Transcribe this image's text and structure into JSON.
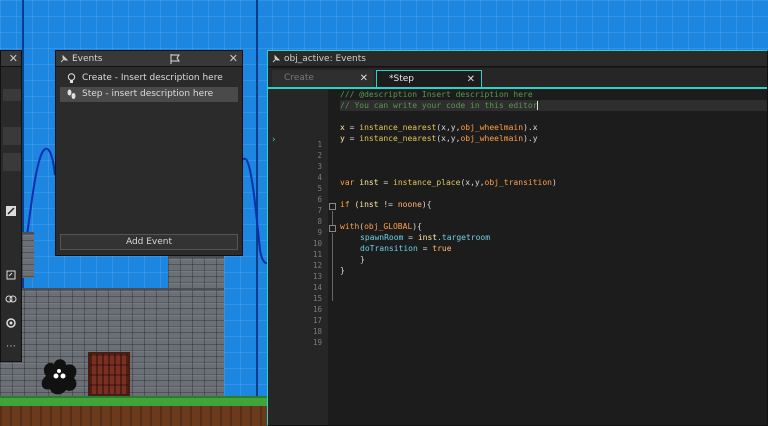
{
  "left_panel": {
    "close_label": "✕"
  },
  "events_panel": {
    "title": "Events",
    "close_label": "✕",
    "items": [
      {
        "label": "Create - Insert description here",
        "icon": "lightbulb-icon",
        "selected": false
      },
      {
        "label": "Step - insert description here",
        "icon": "footsteps-icon",
        "selected": true
      }
    ],
    "add_event_label": "Add Event"
  },
  "editor": {
    "title": "obj_active: Events",
    "tabs": [
      {
        "label": "Create",
        "active": false,
        "close": "✕"
      },
      {
        "label": "*Step",
        "active": true,
        "close": "✕"
      }
    ],
    "line_numbers": [
      "1",
      "2",
      "3",
      "4",
      "5",
      "6",
      "7",
      "8",
      "9",
      "10",
      "11",
      "12",
      "13",
      "14",
      "15",
      "16",
      "17",
      "18",
      "19"
    ],
    "lines": {
      "l1": "/// @description Insert description here",
      "l2": "// You can write your code in this editor",
      "l4a": "x",
      "l4b": " = ",
      "l4c": "instance_nearest",
      "l4d": "(x,y,",
      "l4e": "obj_wheelmain",
      "l4f": ").x",
      "l5a": "y",
      "l5b": " = ",
      "l5c": "instance_nearest",
      "l5d": "(x,y,",
      "l5e": "obj_wheelmain",
      "l5f": ").y",
      "l9a": "var",
      "l9b": " inst",
      "l9c": " = ",
      "l9d": "instance_place",
      "l9e": "(x,y,",
      "l9f": "obj_transition",
      "l9g": ")",
      "l11a": "if",
      "l11b": " (inst",
      "l11c": " != ",
      "l11d": "noone",
      "l11e": "){",
      "l13a": "with",
      "l13b": "(",
      "l13c": "obj_GLOBAL",
      "l13d": "){",
      "l14a": "spawnRoom",
      "l14b": " = ",
      "l14c": "inst",
      "l14d": ".targetroom",
      "l15a": "doTransition",
      "l15b": " = ",
      "l15c": "true",
      "l16": "}",
      "l17": "}"
    }
  },
  "colors": {
    "accent": "#2dd1c6",
    "room_bg": "#1d86e0",
    "comment": "#5c9652",
    "keyword": "#ff9f47"
  }
}
